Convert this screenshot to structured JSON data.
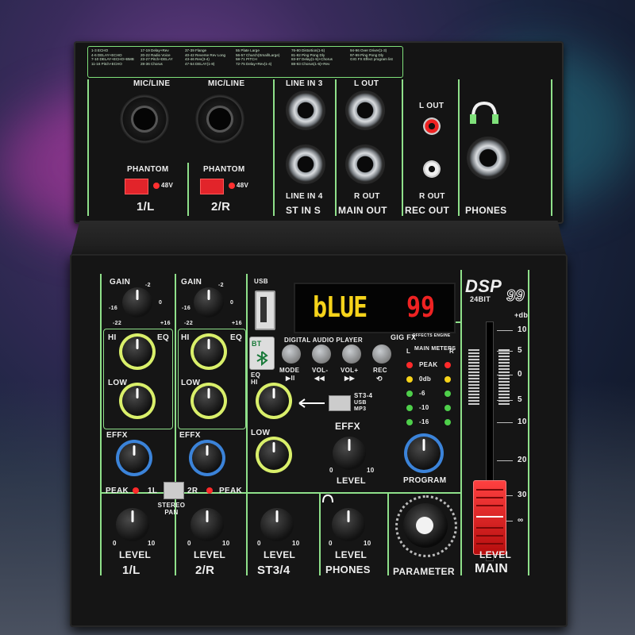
{
  "legend": {
    "col1": [
      "1-3 ECHO",
      "4-6 DELAY+ECHO",
      "7-10 DELAY+ECHO+BMB",
      "11-16 Pitch+ECHO"
    ],
    "col2": [
      "17-19 Delay+Rev",
      "20-22 Radio Voice",
      "23-27 Pitch+DELAY",
      "28-36 Chorus"
    ],
    "col3": [
      "37-39 Flange",
      "40-42 Reverse Rev Long",
      "43-46 Rev(3-4)",
      "47-54 DELAY(1-8)"
    ],
    "col4": [
      "55 Plate Large",
      "56-57 Church(Small/Large)",
      "58-71 PITCH",
      "72-75 Delay+Rev(1-4)"
    ],
    "col5": [
      "76-80 Distortion(1-5)",
      "81-82 Ping Pong Dly",
      "83-87 Delay(1-5)+Chorus",
      "88-93 Chorus(1-6)+Rev"
    ],
    "col6": [
      "94-96 Over Driver(1-3)",
      "97-99 Ping Pong Dly",
      "GIG FX Effect program list"
    ]
  },
  "top": {
    "mic1": "MIC/LINE",
    "mic2": "MIC/LINE",
    "phantom1": "PHANTOM",
    "phantom2": "PHANTOM",
    "v48a": "48V",
    "v48b": "48V",
    "ch1": "1/L",
    "ch2": "2/R",
    "line_in3": "LINE IN 3",
    "line_in4": "LINE IN 4",
    "st_in": "ST IN S",
    "l_out": "L OUT",
    "r_out": "R OUT",
    "main_out": "MAIN OUT",
    "rec_l_out": "L OUT",
    "rec_r_out": "R OUT",
    "rec_out": "REC OUT",
    "phones": "PHONES"
  },
  "panel": {
    "gain1": "GAIN",
    "gain2": "GAIN",
    "gain_scale": [
      "-2",
      "-16",
      "0",
      "-22",
      "+16"
    ],
    "hi1": "HI",
    "eq1": "EQ",
    "low1": "LOW",
    "hi2": "HI",
    "eq2": "EQ",
    "low2": "LOW",
    "effx1": "EFFX",
    "effx2": "EFFX",
    "peak_left": "PEAK",
    "peak_right": "PEAK",
    "pan_1l": "1L",
    "pan_2r": "2R",
    "stereo_pan": "STEREO PAN",
    "level1": "LEVEL",
    "level2": "LEVEL",
    "level3": "LEVEL",
    "level4": "LEVEL",
    "ch_1l": "1/L",
    "ch_2r": "2/R",
    "ch_st34": "ST3/4",
    "ch_phones": "PHONES",
    "usb": "USB",
    "bt": "BT",
    "dap": "DIGITAL AUDIO PLAYER",
    "mode": "MODE",
    "mode_sym": "▶II",
    "volm": "VOL-",
    "volm_sym": "◀◀",
    "volp": "VOL+",
    "volp_sym": "▶▶",
    "rec": "REC",
    "rec_sym": "⟲",
    "eq_hi": "EQ HI",
    "low3": "LOW",
    "st34_label": "ST3-4",
    "usb_mp3": "USB MP3",
    "effx_main": "EFFX",
    "level_fx": "LEVEL",
    "program": "PROGRAM",
    "parameter": "PARAMETER",
    "dsp": "DSP",
    "bit24": "24BIT",
    "dsp_num": "99",
    "gigfx": "GIG FX",
    "effects_engine": "EFFECTS ENGINE",
    "main_meters": "MAIN METERS",
    "meter_l": "L",
    "meter_r": "R",
    "meter_labels": [
      "PEAK",
      "0db",
      "-6",
      "-10",
      "-16"
    ],
    "db_unit": "+db",
    "fader_scale": [
      "10",
      "5",
      "0",
      "5",
      "10",
      "20",
      "30",
      "∞"
    ],
    "main_level": "LEVEL",
    "main": "MAIN",
    "scale_0": "0",
    "scale_10": "10"
  },
  "display": {
    "text": "bLUE",
    "number": "99"
  },
  "colors": {
    "accent": "#7fe07a",
    "panel": "#151515",
    "led_red": "#ee2222",
    "led_yellow": "#f6d31a",
    "fader": "#e2242a"
  }
}
